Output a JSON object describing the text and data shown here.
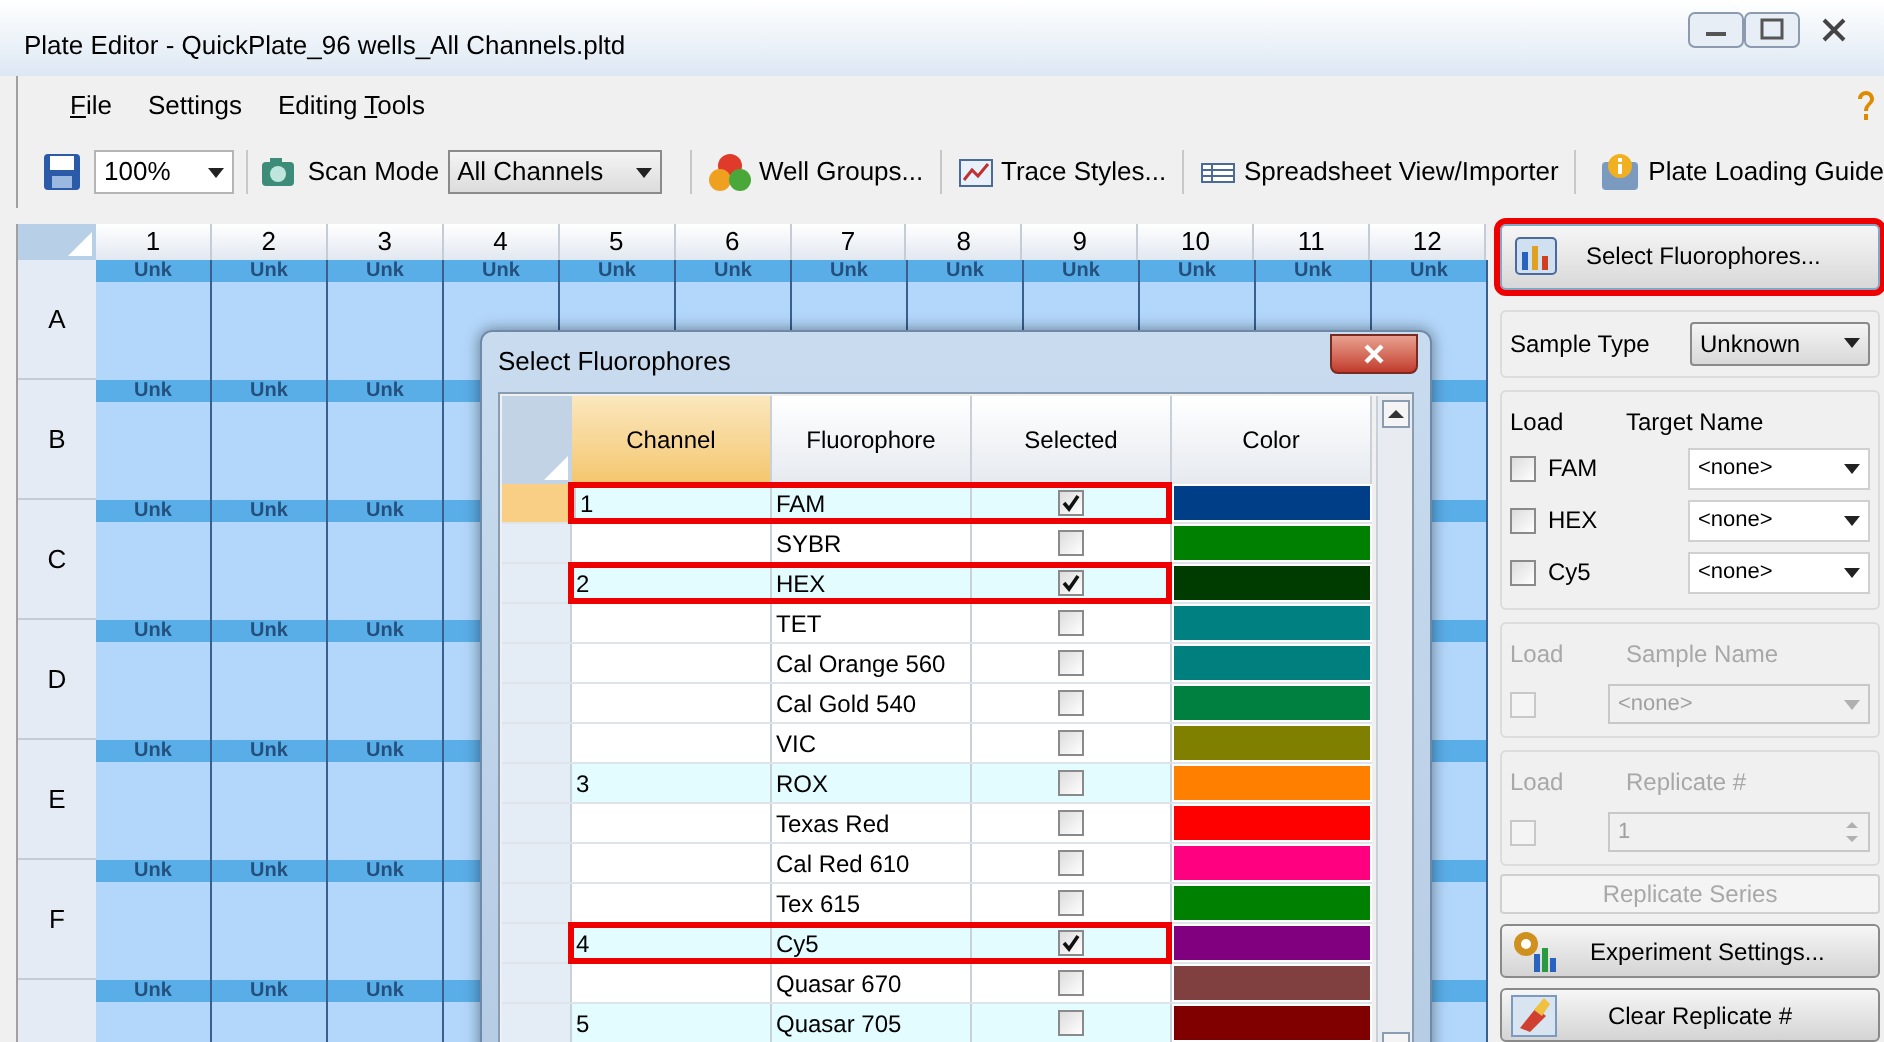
{
  "window": {
    "title": "Plate Editor - QuickPlate_96 wells_All Channels.pltd"
  },
  "menu": [
    {
      "label": "File"
    },
    {
      "label": "Settings"
    },
    {
      "label": "Editing Tools"
    }
  ],
  "toolbar": {
    "zoom": "100%",
    "scan_mode_label": "Scan Mode",
    "scan_mode": "All Channels",
    "buttons": [
      {
        "kind": "groups",
        "label": "Well Groups..."
      },
      {
        "kind": "trace",
        "label": "Trace Styles..."
      },
      {
        "kind": "sheet",
        "label": "Spreadsheet View/Importer"
      }
    ],
    "guide": "Plate Loading Guide"
  },
  "plate": {
    "columns": [
      "1",
      "2",
      "3",
      "4",
      "5",
      "6",
      "7",
      "8",
      "9",
      "10",
      "11",
      "12"
    ],
    "rows": [
      {
        "label": "A",
        "cells": [
          "Unk",
          "Unk",
          "Unk",
          "Unk",
          "Unk",
          "Unk",
          "Unk",
          "Unk",
          "Unk",
          "Unk",
          "Unk",
          "Unk"
        ]
      },
      {
        "label": "B",
        "cells": [
          "Unk",
          "Unk",
          "Unk"
        ]
      },
      {
        "label": "C",
        "cells": [
          "Unk",
          "Unk",
          "Unk"
        ]
      },
      {
        "label": "D",
        "cells": [
          "Unk",
          "Unk",
          "Unk"
        ]
      },
      {
        "label": "E",
        "cells": [
          "Unk",
          "Unk",
          "Unk"
        ]
      },
      {
        "label": "F",
        "cells": [
          "Unk",
          "Unk",
          "Unk"
        ]
      },
      {
        "cells": [
          "Unk",
          "Unk",
          "Unk"
        ]
      }
    ]
  },
  "dialog": {
    "title": "Select Fluorophores",
    "columns": [
      "Channel",
      "Fluorophore",
      "Selected",
      "Color"
    ],
    "rows": [
      {
        "channel": "1",
        "fluorophore": "FAM",
        "selected": true,
        "color": "#003f87",
        "highlighted": true,
        "current": true
      },
      {
        "fluorophore": "SYBR",
        "selected": false,
        "color": "#008000",
        "highlighted": false,
        "current": false
      },
      {
        "channel": "2",
        "fluorophore": "HEX",
        "selected": true,
        "color": "#003c00",
        "highlighted": true,
        "current": false
      },
      {
        "fluorophore": "TET",
        "selected": false,
        "color": "#008080",
        "highlighted": false,
        "current": false
      },
      {
        "fluorophore": "Cal Orange 560",
        "selected": false,
        "color": "#007f7f",
        "highlighted": false,
        "current": false
      },
      {
        "fluorophore": "Cal Gold 540",
        "selected": false,
        "color": "#008040",
        "highlighted": false,
        "current": false
      },
      {
        "fluorophore": "VIC",
        "selected": false,
        "color": "#808000",
        "highlighted": false,
        "current": false
      },
      {
        "channel": "3",
        "fluorophore": "ROX",
        "selected": false,
        "color": "#ff8000",
        "highlighted": false,
        "current": false
      },
      {
        "fluorophore": "Texas Red",
        "selected": false,
        "color": "#ff0000",
        "highlighted": false,
        "current": false
      },
      {
        "fluorophore": "Cal Red 610",
        "selected": false,
        "color": "#ff0080",
        "highlighted": false,
        "current": false
      },
      {
        "fluorophore": "Tex 615",
        "selected": false,
        "color": "#008001",
        "highlighted": false,
        "current": false
      },
      {
        "channel": "4",
        "fluorophore": "Cy5",
        "selected": true,
        "color": "#800080",
        "highlighted": true,
        "current": false
      },
      {
        "fluorophore": "Quasar 670",
        "selected": false,
        "color": "#804040",
        "highlighted": false,
        "current": false
      },
      {
        "channel": "5",
        "fluorophore": "Quasar 705",
        "selected": false,
        "color": "#800000",
        "highlighted": false,
        "current": false
      }
    ]
  },
  "panel": {
    "select_button": {
      "label": "Select Fluorophores...",
      "highlighted": true
    },
    "sample_type_label": "Sample Type",
    "sample_type": "Unknown",
    "targets": {
      "load_label": "Load",
      "name_label": "Target Name",
      "rows": [
        {
          "label": "FAM",
          "checked": false,
          "value": "<none>"
        },
        {
          "label": "HEX",
          "checked": false,
          "value": "<none>"
        },
        {
          "label": "Cy5",
          "checked": false,
          "value": "<none>"
        }
      ]
    },
    "sample": {
      "load_label": "Load",
      "name_label": "Sample Name",
      "checked": false,
      "value": "<none>",
      "disabled": true
    },
    "replicate": {
      "load_label": "Load",
      "name_label": "Replicate #",
      "checked": false,
      "value": "1",
      "disabled": true
    },
    "replicate_series": {
      "label": "Replicate Series",
      "disabled": true
    },
    "experiment_button": "Experiment Settings...",
    "clear_button": "Clear Replicate #"
  }
}
